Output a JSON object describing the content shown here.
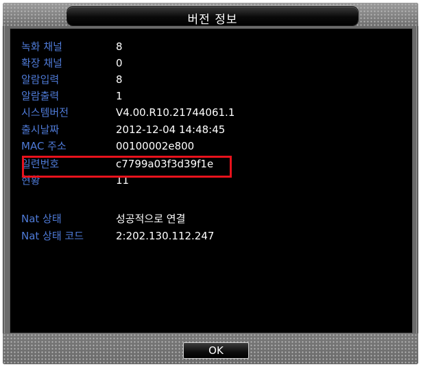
{
  "dialog": {
    "title": "버전 정보",
    "ok_label": "OK",
    "highlight_color": "#e8121c",
    "label_color": "#4f7bd8"
  },
  "info": [
    {
      "label": "녹화 채널",
      "value": "8"
    },
    {
      "label": "확장 채널",
      "value": "0"
    },
    {
      "label": "알람입력",
      "value": "8"
    },
    {
      "label": "알람출력",
      "value": "1"
    },
    {
      "label": "시스템버전",
      "value": "V4.00.R10.21744061.1"
    },
    {
      "label": "출시날짜",
      "value": "2012-12-04 14:48:45"
    },
    {
      "label": "MAC 주소",
      "value": "00100002e800"
    },
    {
      "label": "일련번호",
      "value": "c7799a03f3d39f1e"
    },
    {
      "label": "현황",
      "value": "11"
    }
  ],
  "nat": [
    {
      "label": "Nat 상태",
      "value": "성공적으로 연결"
    },
    {
      "label": "Nat 상태 코드",
      "value": "2:202.130.112.247"
    }
  ]
}
